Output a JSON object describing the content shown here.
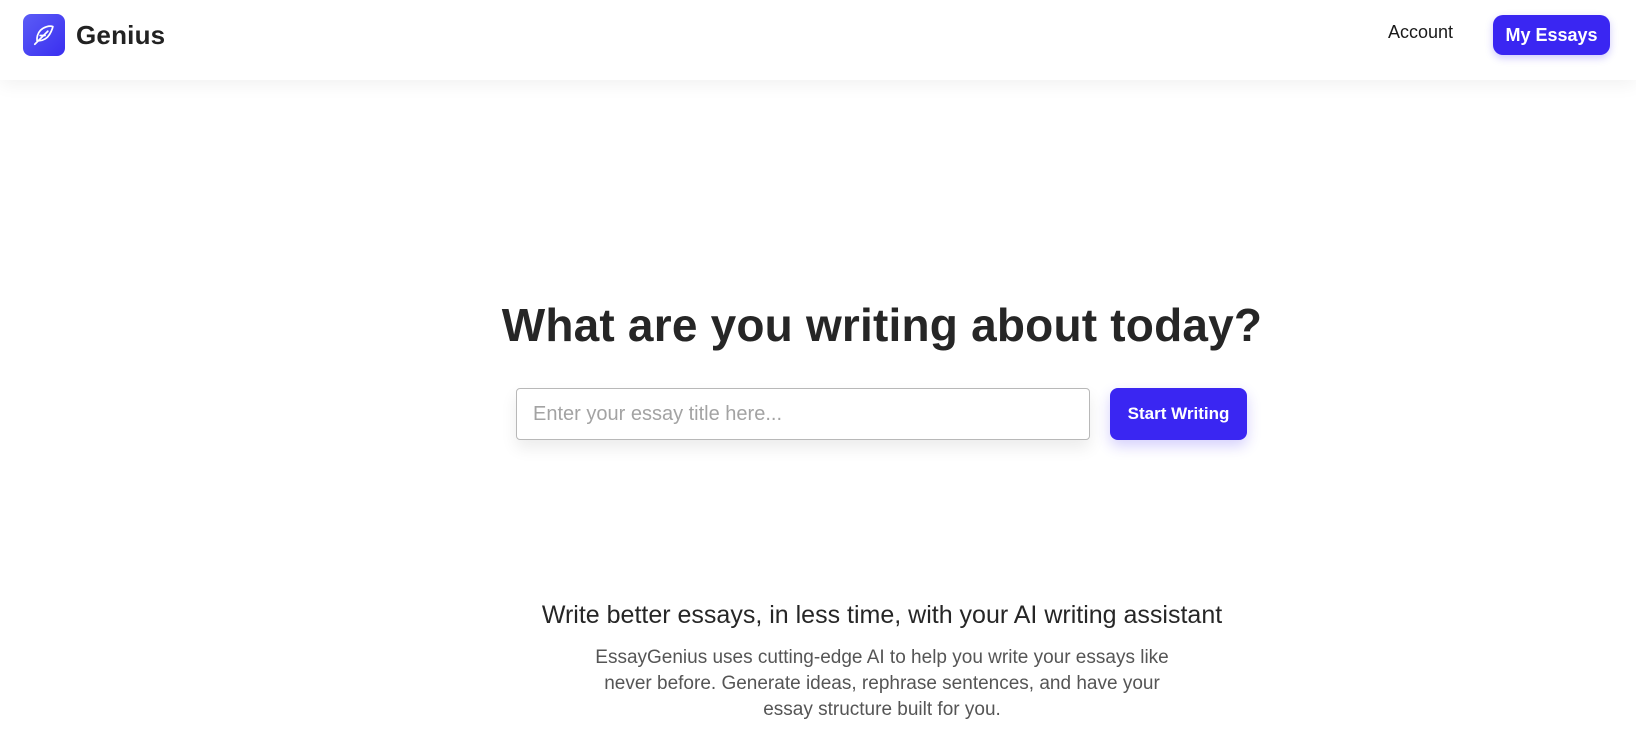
{
  "header": {
    "brand": "Genius",
    "account_link": "Account",
    "my_essays_button": "My Essays"
  },
  "hero": {
    "title": "What are you writing about today?",
    "input_placeholder": "Enter your essay title here...",
    "input_value": "",
    "start_button": "Start Writing"
  },
  "features": {
    "heading": "Write better essays, in less time, with your AI writing assistant",
    "description": "EssayGenius uses cutting-edge AI to help you write your essays like never before. Generate ideas, rephrase sentences, and have your essay structure built for you."
  },
  "colors": {
    "accent": "#3a26f2",
    "logo_gradient_start": "#5b5cf6",
    "logo_gradient_end": "#3a2ff0",
    "text_dark": "#262626",
    "text_muted": "#555555"
  },
  "icons": {
    "logo": "feather-icon"
  }
}
